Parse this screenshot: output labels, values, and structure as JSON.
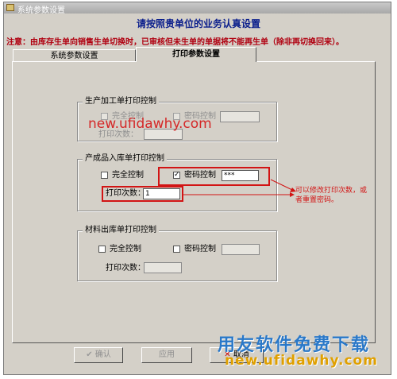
{
  "window": {
    "title": "系统参数设置"
  },
  "heading": "请按照贵单位的业务认真设置",
  "notice": "注意：由库存生单向销售生单切换时，已审核但未生单的单据将不能再生单（除非再切换回来）。",
  "tabs": [
    {
      "label": "系统参数设置",
      "active": false
    },
    {
      "label": "打印参数设置",
      "active": true
    }
  ],
  "groups": {
    "production": {
      "title": "生产加工单打印控制",
      "full_control": {
        "label": "完全控制",
        "checked": false,
        "enabled": false
      },
      "password_control": {
        "label": "密码控制",
        "checked": false,
        "enabled": false
      },
      "password_value": "",
      "print_count_label": "打印次数：",
      "print_count_value": ""
    },
    "finished_goods": {
      "title": "产成品入库单打印控制",
      "full_control": {
        "label": "完全控制",
        "checked": false,
        "enabled": true
      },
      "password_control": {
        "label": "密码控制",
        "checked": true,
        "enabled": true
      },
      "password_value": "***",
      "print_count_label": "打印次数：",
      "print_count_value": "1"
    },
    "material_out": {
      "title": "材料出库单打印控制",
      "full_control": {
        "label": "完全控制",
        "checked": false,
        "enabled": true
      },
      "password_control": {
        "label": "密码控制",
        "checked": false,
        "enabled": true
      },
      "password_value": "",
      "print_count_label": "打印次数：",
      "print_count_value": ""
    }
  },
  "annotation": {
    "callout": "可以修改打印次数，或者重置密码。",
    "color": "#d21414"
  },
  "buttons": {
    "confirm": {
      "label": "确认",
      "enabled": false
    },
    "apply": {
      "label": "应用",
      "enabled": false
    },
    "cancel": {
      "label": "取消",
      "enabled": true
    }
  },
  "watermarks": {
    "center": "new.ufidawhy.com",
    "brand": "用友软件免费下载",
    "site": "new.ufidawhy.com"
  },
  "icons": {
    "check": "checkmark-icon",
    "close": "close-x-icon",
    "arrow": "arrow-icon"
  }
}
